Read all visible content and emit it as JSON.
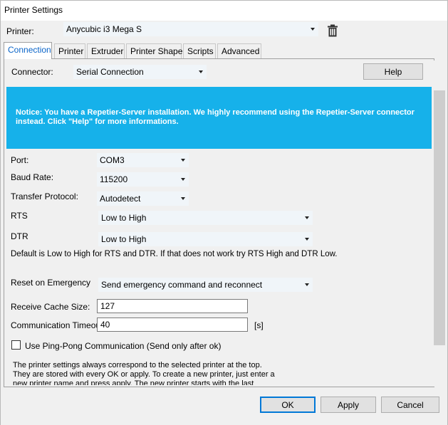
{
  "window": {
    "title": "Printer Settings"
  },
  "printer": {
    "label": "Printer:",
    "selected": "Anycubic i3 Mega S"
  },
  "tabs": [
    {
      "label": "Connection"
    },
    {
      "label": "Printer"
    },
    {
      "label": "Extruder"
    },
    {
      "label": "Printer Shape"
    },
    {
      "label": "Scripts"
    },
    {
      "label": "Advanced"
    }
  ],
  "connection": {
    "connector_label": "Connector:",
    "connector_value": "Serial Connection",
    "help_label": "Help",
    "notice": "Notice: You have a Repetier-Server installation. We highly recommend using the Repetier-Server connector instead. Click \"Help\" for more informations.",
    "port_label": "Port:",
    "port_value": "COM3",
    "baud_label": "Baud Rate:",
    "baud_value": "115200",
    "protocol_label": "Transfer Protocol:",
    "protocol_value": "Autodetect",
    "rts_label": "RTS",
    "rts_value": "Low to High",
    "dtr_label": "DTR",
    "dtr_value": "Low to High",
    "rts_dtr_hint": "Default is Low to High for RTS and DTR. If that does not work try RTS High and DTR Low.",
    "reset_label": "Reset on Emergency",
    "reset_value": "Send emergency command and reconnect",
    "cache_label": "Receive Cache Size:",
    "cache_value": "127",
    "timeout_label": "Communication Timeout:",
    "timeout_value": "40",
    "timeout_unit": "[s]",
    "pingpong_label": "Use Ping-Pong Communication (Send only after ok)",
    "pingpong_checked": false,
    "info": "The printer settings always correspond to the selected printer at the top. They are stored with every OK or apply. To create a new printer, just enter a new printer name and press apply. The new printer starts with the last settings."
  },
  "footer": {
    "ok": "OK",
    "apply": "Apply",
    "cancel": "Cancel"
  },
  "colors": {
    "notice_bg": "#16b1ea",
    "accent": "#0078d7",
    "active_tab_text": "#0a64c8"
  }
}
